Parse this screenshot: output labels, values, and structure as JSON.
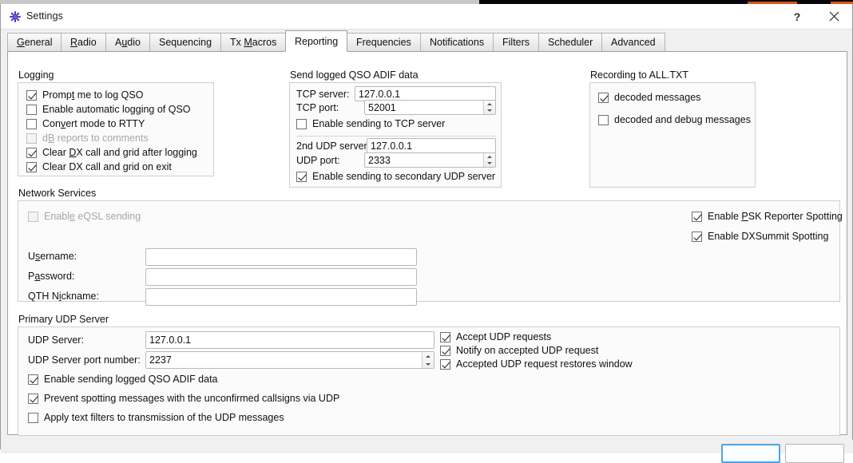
{
  "window": {
    "title": "Settings",
    "icon": "app-star-icon",
    "help_label": "?",
    "close_label": "✕"
  },
  "tabs": [
    {
      "label": "General",
      "mnemonic": "G",
      "selected": false
    },
    {
      "label": "Radio",
      "mnemonic": "R",
      "selected": false
    },
    {
      "label": "Audio",
      "mnemonic": "u",
      "selected": false
    },
    {
      "label": "Sequencing",
      "mnemonic": "",
      "selected": false
    },
    {
      "label": "Tx Macros",
      "mnemonic": "M",
      "selected": false
    },
    {
      "label": "Reporting",
      "mnemonic": "g",
      "selected": true
    },
    {
      "label": "Frequencies",
      "mnemonic": "",
      "selected": false
    },
    {
      "label": "Notifications",
      "mnemonic": "",
      "selected": false
    },
    {
      "label": "Filters",
      "mnemonic": "",
      "selected": false
    },
    {
      "label": "Scheduler",
      "mnemonic": "",
      "selected": false
    },
    {
      "label": "Advanced",
      "mnemonic": "",
      "selected": false
    }
  ],
  "logging": {
    "title": "Logging",
    "items": [
      {
        "label": "Prompt me to log QSO",
        "checked": true,
        "disabled": false
      },
      {
        "label": "Enable automatic logging of QSO",
        "checked": false,
        "disabled": false
      },
      {
        "label": "Convert mode to RTTY",
        "checked": false,
        "disabled": false
      },
      {
        "label": "dB reports to comments",
        "checked": false,
        "disabled": true
      },
      {
        "label": "Clear DX call and grid after logging",
        "checked": true,
        "disabled": false
      },
      {
        "label": "Clear DX call and grid on exit",
        "checked": true,
        "disabled": false
      }
    ]
  },
  "adif": {
    "title": "Send logged QSO ADIF data",
    "tcp_server_label": "TCP server:",
    "tcp_server_value": "127.0.0.1",
    "tcp_port_label": "TCP port:",
    "tcp_port_value": "52001",
    "enable_tcp_label": "Enable sending to TCP server",
    "enable_tcp_checked": false,
    "udp2_server_label": "2nd UDP server",
    "udp2_server_value": "127.0.0.1",
    "udp2_port_label": "UDP port:",
    "udp2_port_value": "2333",
    "enable_udp2_label": "Enable sending to secondary UDP server",
    "enable_udp2_checked": true
  },
  "recording": {
    "title": "Recording to ALL.TXT",
    "items": [
      {
        "label": "decoded messages",
        "checked": true
      },
      {
        "label": "decoded and debug messages",
        "checked": false
      }
    ]
  },
  "network_services": {
    "title": "Network Services",
    "eqsl_label": "Enable eQSL sending",
    "eqsl_checked": false,
    "eqsl_disabled": true,
    "username_label": "Username:",
    "username_value": "",
    "password_label": "Password:",
    "password_value": "",
    "qth_label": "QTH Nickname:",
    "qth_value": "",
    "spotting": [
      {
        "label": "Enable PSK Reporter Spotting",
        "checked": true
      },
      {
        "label": "Enable DXSummit Spotting",
        "checked": true
      }
    ]
  },
  "primary_udp": {
    "title": "Primary UDP Server",
    "server_label": "UDP Server:",
    "server_value": "127.0.0.1",
    "port_label": "UDP Server port number:",
    "port_value": "2237",
    "right_options": [
      {
        "label": "Accept UDP requests",
        "checked": true
      },
      {
        "label": "Notify on accepted UDP request",
        "checked": true
      },
      {
        "label": "Accepted UDP request restores window",
        "checked": true
      }
    ],
    "bottom_options": [
      {
        "label": "Enable sending logged QSO ADIF data",
        "checked": true
      },
      {
        "label": "Prevent spotting messages with the unconfirmed callsigns via UDP",
        "checked": true
      },
      {
        "label": "Apply text filters to transmission of the UDP messages",
        "checked": false
      }
    ]
  },
  "colors": {
    "accent_focus": "#4aa3e8",
    "window_bg": "#f0f0f0",
    "page_bg": "#ffffff",
    "group_border": "#cfcfcf"
  }
}
